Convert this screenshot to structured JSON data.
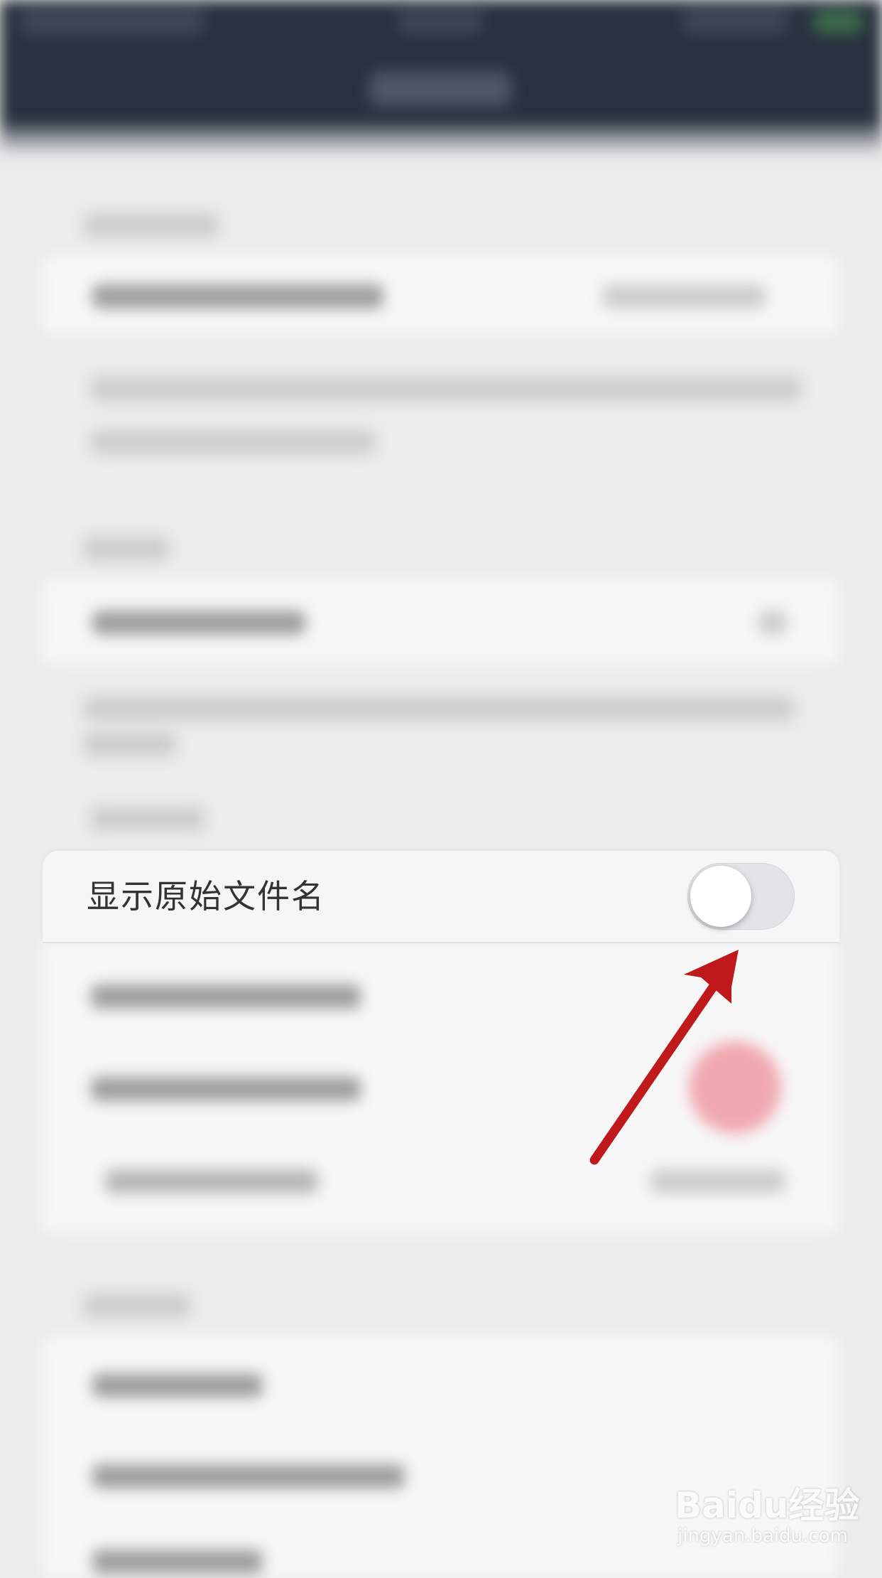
{
  "setting_row": {
    "label": "显示原始文件名",
    "toggle_on": false
  },
  "annotation": {
    "arrow_color": "#c0191c",
    "points_to": "show-original-filename-toggle"
  },
  "watermark": {
    "brand": "Baidu经验",
    "url": "jingyan.baidu.com"
  },
  "colors": {
    "top_bar": "#28313f",
    "page_background": "#ececec",
    "toggle_off_track": "#e2e3e6",
    "toggle_knob": "#ffffff"
  }
}
